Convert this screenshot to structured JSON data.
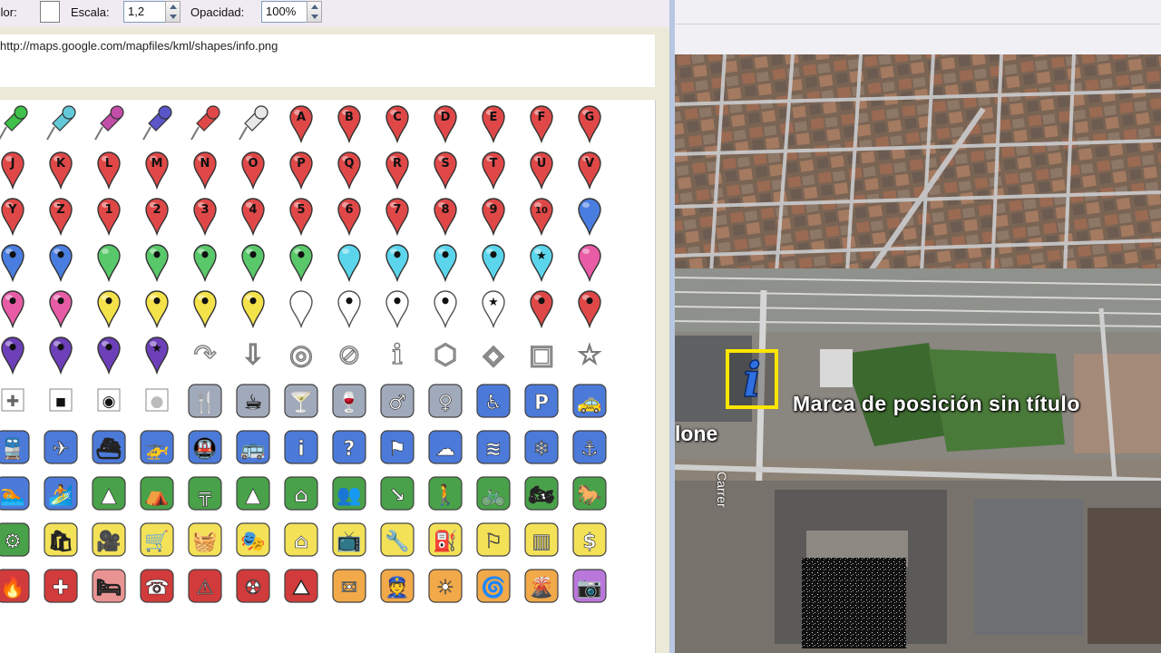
{
  "toolbar": {
    "color_label": "Color:",
    "scale_label": "Escala:",
    "scale_value": "1,2",
    "opacity_label": "Opacidad:",
    "opacity_value": "100%"
  },
  "icon_url": "http://maps.google.com/mapfiles/kml/shapes/info.png",
  "colors": {
    "red_pin": "#e04848",
    "blue_pin": "#4a7de0",
    "green_pin": "#59c86a",
    "cyan_pin": "#5bd5ec",
    "pink_pin": "#e85ca6",
    "yellow_pin": "#f4e24a",
    "purple_pin": "#6d3fb8",
    "icon_blue": "#3d6fd6",
    "icon_green": "#3a9a3a",
    "icon_yellow": "#f3e04a",
    "icon_red": "#cf2b2b",
    "icon_orange": "#f0a23a",
    "highlight": "#ffe600"
  },
  "icon_grid": [
    [
      {
        "k": "push",
        "c": "#3ec04a"
      },
      {
        "k": "push",
        "c": "#63c9d8"
      },
      {
        "k": "push",
        "c": "#c24ea8"
      },
      {
        "k": "push",
        "c": "#5a55c9"
      },
      {
        "k": "push",
        "c": "#e04848"
      },
      {
        "k": "push",
        "c": "#e8e8e8"
      },
      {
        "k": "pin",
        "c": "#e04848",
        "t": "A"
      },
      {
        "k": "pin",
        "c": "#e04848",
        "t": "B"
      },
      {
        "k": "pin",
        "c": "#e04848",
        "t": "C"
      },
      {
        "k": "pin",
        "c": "#e04848",
        "t": "D"
      },
      {
        "k": "pin",
        "c": "#e04848",
        "t": "E"
      },
      {
        "k": "pin",
        "c": "#e04848",
        "t": "F"
      },
      {
        "k": "pin",
        "c": "#e04848",
        "t": "G"
      }
    ],
    [
      {
        "k": "pin",
        "c": "#e04848",
        "t": "J"
      },
      {
        "k": "pin",
        "c": "#e04848",
        "t": "K"
      },
      {
        "k": "pin",
        "c": "#e04848",
        "t": "L"
      },
      {
        "k": "pin",
        "c": "#e04848",
        "t": "M"
      },
      {
        "k": "pin",
        "c": "#e04848",
        "t": "N"
      },
      {
        "k": "pin",
        "c": "#e04848",
        "t": "O"
      },
      {
        "k": "pin",
        "c": "#e04848",
        "t": "P"
      },
      {
        "k": "pin",
        "c": "#e04848",
        "t": "Q"
      },
      {
        "k": "pin",
        "c": "#e04848",
        "t": "R"
      },
      {
        "k": "pin",
        "c": "#e04848",
        "t": "S"
      },
      {
        "k": "pin",
        "c": "#e04848",
        "t": "T"
      },
      {
        "k": "pin",
        "c": "#e04848",
        "t": "U"
      },
      {
        "k": "pin",
        "c": "#e04848",
        "t": "V"
      }
    ],
    [
      {
        "k": "pin",
        "c": "#e04848",
        "t": "Y"
      },
      {
        "k": "pin",
        "c": "#e04848",
        "t": "Z"
      },
      {
        "k": "pin",
        "c": "#e04848",
        "t": "1"
      },
      {
        "k": "pin",
        "c": "#e04848",
        "t": "2"
      },
      {
        "k": "pin",
        "c": "#e04848",
        "t": "3"
      },
      {
        "k": "pin",
        "c": "#e04848",
        "t": "4"
      },
      {
        "k": "pin",
        "c": "#e04848",
        "t": "5"
      },
      {
        "k": "pin",
        "c": "#e04848",
        "t": "6"
      },
      {
        "k": "pin",
        "c": "#e04848",
        "t": "7"
      },
      {
        "k": "pin",
        "c": "#e04848",
        "t": "8"
      },
      {
        "k": "pin",
        "c": "#e04848",
        "t": "9"
      },
      {
        "k": "pin",
        "c": "#e04848",
        "t": "10"
      },
      {
        "k": "pin",
        "c": "#4a7de0",
        "t": ""
      }
    ],
    [
      {
        "k": "pin",
        "c": "#4a7de0",
        "t": "•"
      },
      {
        "k": "pin",
        "c": "#4a7de0",
        "t": "•"
      },
      {
        "k": "pin",
        "c": "#59c86a",
        "t": ""
      },
      {
        "k": "pin",
        "c": "#59c86a",
        "t": "•"
      },
      {
        "k": "pin",
        "c": "#59c86a",
        "t": "•"
      },
      {
        "k": "pin",
        "c": "#59c86a",
        "t": "•"
      },
      {
        "k": "pin",
        "c": "#59c86a",
        "t": "•"
      },
      {
        "k": "pin",
        "c": "#5bd5ec",
        "t": ""
      },
      {
        "k": "pin",
        "c": "#5bd5ec",
        "t": "•"
      },
      {
        "k": "pin",
        "c": "#5bd5ec",
        "t": "•"
      },
      {
        "k": "pin",
        "c": "#5bd5ec",
        "t": "•"
      },
      {
        "k": "pin",
        "c": "#5bd5ec",
        "t": "★"
      },
      {
        "k": "pin",
        "c": "#e85ca6",
        "t": ""
      }
    ],
    [
      {
        "k": "pin",
        "c": "#e85ca6",
        "t": "•"
      },
      {
        "k": "pin",
        "c": "#e85ca6",
        "t": "•"
      },
      {
        "k": "pin",
        "c": "#f4e24a",
        "t": "•"
      },
      {
        "k": "pin",
        "c": "#f4e24a",
        "t": "•"
      },
      {
        "k": "pin",
        "c": "#f4e24a",
        "t": "•"
      },
      {
        "k": "pin",
        "c": "#f4e24a",
        "t": "•"
      },
      {
        "k": "pin",
        "c": "#ffffff",
        "t": ""
      },
      {
        "k": "pin",
        "c": "#ffffff",
        "t": "•"
      },
      {
        "k": "pin",
        "c": "#ffffff",
        "t": "•"
      },
      {
        "k": "pin",
        "c": "#ffffff",
        "t": "•"
      },
      {
        "k": "pin",
        "c": "#ffffff",
        "t": "★"
      },
      {
        "k": "pin",
        "c": "#e04848",
        "t": "•"
      },
      {
        "k": "pin",
        "c": "#e04848",
        "t": "•"
      }
    ],
    [
      {
        "k": "pin",
        "c": "#6d3fb8",
        "t": "•"
      },
      {
        "k": "pin",
        "c": "#6d3fb8",
        "t": "•"
      },
      {
        "k": "pin",
        "c": "#6d3fb8",
        "t": "•"
      },
      {
        "k": "pin",
        "c": "#6d3fb8",
        "t": "★"
      },
      {
        "k": "outline",
        "s": "↷"
      },
      {
        "k": "outline",
        "s": "⇩"
      },
      {
        "k": "outline",
        "s": "◎"
      },
      {
        "k": "outline",
        "s": "⊘"
      },
      {
        "k": "outline",
        "s": "ℹ"
      },
      {
        "k": "outline",
        "s": "⬡"
      },
      {
        "k": "outline",
        "s": "◈"
      },
      {
        "k": "outline",
        "s": "▣"
      },
      {
        "k": "outline",
        "s": "☆"
      }
    ],
    [
      {
        "k": "small",
        "s": "✚",
        "c": "#666"
      },
      {
        "k": "small",
        "s": "◾",
        "c": "#111"
      },
      {
        "k": "small",
        "s": "◉",
        "c": "#111"
      },
      {
        "k": "small",
        "s": "●",
        "c": "#bbb"
      },
      {
        "k": "sq",
        "s": "🍴",
        "c": "#9aa3b5"
      },
      {
        "k": "sq",
        "s": "☕",
        "c": "#9aa3b5"
      },
      {
        "k": "sq",
        "s": "🍸",
        "c": "#9aa3b5"
      },
      {
        "k": "sq",
        "s": "🍷",
        "c": "#9aa3b5"
      },
      {
        "k": "sq",
        "s": "♂",
        "c": "#9aa3b5"
      },
      {
        "k": "sq",
        "s": "♀",
        "c": "#9aa3b5"
      },
      {
        "k": "sq",
        "s": "♿",
        "c": "#3d6fd6"
      },
      {
        "k": "sq",
        "s": "P",
        "c": "#3d6fd6"
      },
      {
        "k": "sq",
        "s": "🚕",
        "c": "#3d6fd6"
      }
    ],
    [
      {
        "k": "sq",
        "s": "🚆",
        "c": "#3d6fd6"
      },
      {
        "k": "sq",
        "s": "✈",
        "c": "#3d6fd6"
      },
      {
        "k": "sq",
        "s": "⛴",
        "c": "#3d6fd6"
      },
      {
        "k": "sq",
        "s": "🚁",
        "c": "#3d6fd6"
      },
      {
        "k": "sq",
        "s": "🚇",
        "c": "#3d6fd6"
      },
      {
        "k": "sq",
        "s": "🚌",
        "c": "#3d6fd6"
      },
      {
        "k": "sq",
        "s": "i",
        "c": "#3d6fd6"
      },
      {
        "k": "sq",
        "s": "?",
        "c": "#3d6fd6"
      },
      {
        "k": "sq",
        "s": "⚑",
        "c": "#3d6fd6"
      },
      {
        "k": "sq",
        "s": "☁",
        "c": "#3d6fd6"
      },
      {
        "k": "sq",
        "s": "≋",
        "c": "#3d6fd6"
      },
      {
        "k": "sq",
        "s": "❄",
        "c": "#3d6fd6"
      },
      {
        "k": "sq",
        "s": "⚓",
        "c": "#3d6fd6"
      }
    ],
    [
      {
        "k": "sq",
        "s": "🏊",
        "c": "#3d6fd6"
      },
      {
        "k": "sq",
        "s": "🏄",
        "c": "#3d6fd6"
      },
      {
        "k": "sq",
        "s": "▲",
        "c": "#3a9a3a"
      },
      {
        "k": "sq",
        "s": "⛺",
        "c": "#3a9a3a"
      },
      {
        "k": "sq",
        "s": "╦",
        "c": "#3a9a3a"
      },
      {
        "k": "sq",
        "s": "▲",
        "c": "#3a9a3a"
      },
      {
        "k": "sq",
        "s": "⌂",
        "c": "#3a9a3a"
      },
      {
        "k": "sq",
        "s": "👥",
        "c": "#3a9a3a"
      },
      {
        "k": "sq",
        "s": "↘",
        "c": "#3a9a3a"
      },
      {
        "k": "sq",
        "s": "🚶",
        "c": "#3a9a3a"
      },
      {
        "k": "sq",
        "s": "🚲",
        "c": "#3a9a3a"
      },
      {
        "k": "sq",
        "s": "🏍",
        "c": "#3a9a3a"
      },
      {
        "k": "sq",
        "s": "🐎",
        "c": "#3a9a3a"
      }
    ],
    [
      {
        "k": "sq",
        "s": "⚙",
        "c": "#3a9a3a"
      },
      {
        "k": "sq",
        "s": "🛍",
        "c": "#f3e04a"
      },
      {
        "k": "sq",
        "s": "🎥",
        "c": "#f3e04a"
      },
      {
        "k": "sq",
        "s": "🛒",
        "c": "#f3e04a"
      },
      {
        "k": "sq",
        "s": "🧺",
        "c": "#f3e04a"
      },
      {
        "k": "sq",
        "s": "🎭",
        "c": "#f3e04a"
      },
      {
        "k": "sq",
        "s": "⌂",
        "c": "#f3e04a"
      },
      {
        "k": "sq",
        "s": "📺",
        "c": "#f3e04a"
      },
      {
        "k": "sq",
        "s": "🔧",
        "c": "#f3e04a"
      },
      {
        "k": "sq",
        "s": "⛽",
        "c": "#f3e04a"
      },
      {
        "k": "sq",
        "s": "⚐",
        "c": "#f3e04a"
      },
      {
        "k": "sq",
        "s": "▥",
        "c": "#f3e04a"
      },
      {
        "k": "sq",
        "s": "$",
        "c": "#f3e04a"
      }
    ],
    [
      {
        "k": "sq",
        "s": "🔥",
        "c": "#cf2b2b"
      },
      {
        "k": "sq",
        "s": "✚",
        "c": "#cf2b2b"
      },
      {
        "k": "sq",
        "s": "🛏",
        "c": "#e88a8a"
      },
      {
        "k": "sq",
        "s": "☎",
        "c": "#cf2b2b"
      },
      {
        "k": "sq",
        "s": "⚠",
        "c": "#cf2b2b"
      },
      {
        "k": "sq",
        "s": "☢",
        "c": "#cf2b2b"
      },
      {
        "k": "sq",
        "s": "⛰",
        "c": "#cf2b2b"
      },
      {
        "k": "sq",
        "s": "✉",
        "c": "#f0a23a"
      },
      {
        "k": "sq",
        "s": "👮",
        "c": "#f0a23a"
      },
      {
        "k": "sq",
        "s": "☀",
        "c": "#f0a23a"
      },
      {
        "k": "sq",
        "s": "🌀",
        "c": "#f0a23a"
      },
      {
        "k": "sq",
        "s": "🌋",
        "c": "#f0a23a"
      },
      {
        "k": "sq",
        "s": "📷",
        "c": "#b56cd8"
      }
    ]
  ],
  "map": {
    "placemark_label": "Marca de posición sin título",
    "cut_label": "lone",
    "street_label": "Carrer"
  }
}
